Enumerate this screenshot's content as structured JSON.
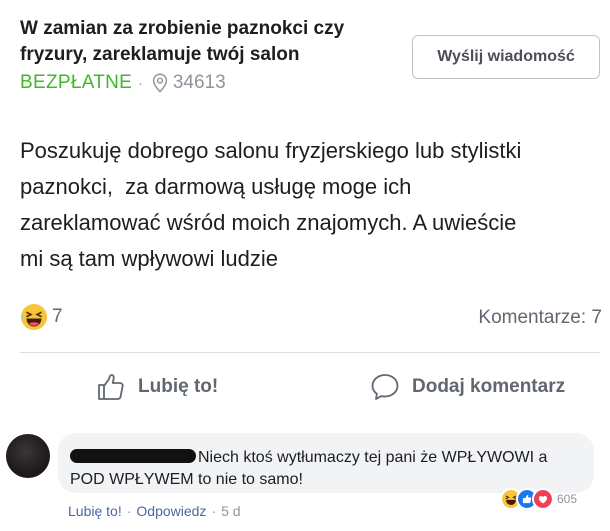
{
  "listing": {
    "title": "W zamian za zrobienie paznokci czy fryzury, zareklamuje twój salon",
    "price": "BEZPŁATNE",
    "separator": "·",
    "location": "34613"
  },
  "message_button": "Wyślij wiadomość",
  "post_text": "Poszukuję dobrego salonu fryzjerskiego lub stylistki\npaznokci,  za darmową usługę moge ich\nzareklamować wśród moich znajomych. A uwieście\nmi są tam wpływowi ludzie",
  "stats": {
    "reaction_icon": "haha-emoji-icon",
    "reaction_count": "7",
    "comments": "Komentarze: 7"
  },
  "actions": {
    "like": "Lubię to!",
    "comment": "Dodaj komentarz"
  },
  "comment": {
    "text_line1": "Niech ktoś wytłumaczy tej pani że WPŁYWOWI a",
    "text_line2": "POD WPŁYWEM to nie to samo!",
    "reaction_icons": [
      "haha-emoji-icon",
      "like-icon",
      "love-icon"
    ],
    "reaction_count": "605",
    "like_link": "Lubię to!",
    "reply_link": "Odpowiedz",
    "separator": "·",
    "time": "5 d"
  },
  "colors": {
    "price_green": "#42b72a",
    "link_blue": "#4b67a1",
    "muted_gray": "#90949c",
    "bubble_bg": "#f2f3f5"
  }
}
